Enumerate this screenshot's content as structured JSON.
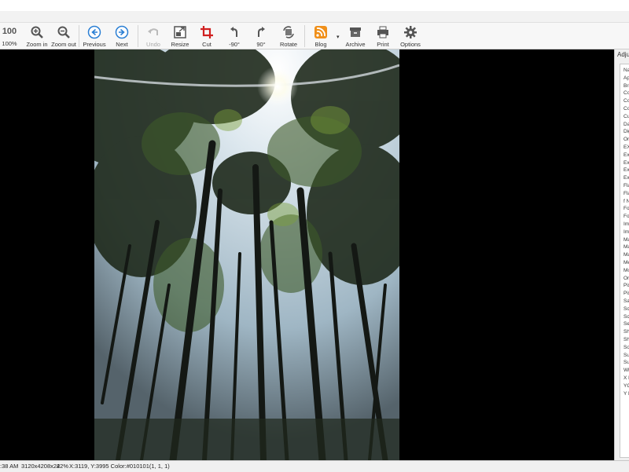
{
  "toolbar": {
    "zoom_value": "100",
    "zoom_label": "100%",
    "zoom_in": "Zoom in",
    "zoom_out": "Zoom out",
    "previous": "Previous",
    "next": "Next",
    "undo": "Undo",
    "resize": "Resize",
    "cut": "Cut",
    "rotate_left": "-90°",
    "rotate_right": "90°",
    "rotate": "Rotate",
    "blog": "Blog",
    "archive": "Archive",
    "print": "Print",
    "options": "Options"
  },
  "icons": {
    "zoom_in": "magnifier-plus-icon",
    "zoom_out": "magnifier-minus-icon",
    "previous": "left-arrow-circle-icon",
    "next": "right-arrow-circle-icon",
    "undo": "undo-arrow-icon",
    "resize": "resize-icon",
    "cut": "crop-icon",
    "rotate_left": "rotate-left-icon",
    "rotate_right": "rotate-right-icon",
    "rotate": "rotate-icon",
    "blog": "rss-icon",
    "archive": "archive-icon",
    "print": "printer-icon",
    "options": "gear-icon"
  },
  "colors": {
    "nav_blue": "#2a7fd4",
    "crop_red": "#d02020",
    "rss_orange": "#f0901a"
  },
  "panel": {
    "tab_label": "Adju",
    "items": [
      "Na",
      "Ap",
      "Bri",
      "Co",
      "Co",
      "Co",
      "Cu",
      "Da",
      "Dig",
      "Ori",
      "EX",
      "Ex",
      "Ex",
      "Ex",
      "Ex",
      "Fla",
      "Fla",
      "f N",
      "Fo",
      "Fo",
      "Im",
      "Im",
      "Ma",
      "Ma",
      "Ma",
      "Me",
      "Mo",
      "Ori",
      "Pix",
      "Pix",
      "Sa",
      "Sc",
      "Sc",
      "Se",
      "Sh",
      "Sh",
      "So",
      "Sul",
      "Sul",
      "Wh",
      "X F",
      "YC",
      "Y F"
    ]
  },
  "status": {
    "time": ":38 AM",
    "dimensions": "3120x4208x24",
    "zoom": "22%",
    "cursor": "X:3119, Y:3995 Color:#010101(1, 1, 1)"
  }
}
